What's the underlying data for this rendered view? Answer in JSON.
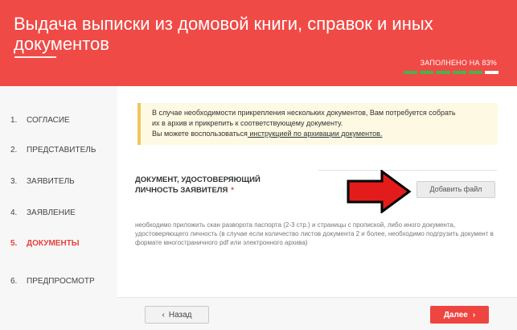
{
  "header": {
    "title": "Выдача выписки из домовой книги, справок и иных документов",
    "progress_label": "ЗАПОЛНЕНО НА 83%",
    "progress_fraction": 0.83,
    "colors": {
      "background": "#f04a46",
      "complete": "#4caf50",
      "incomplete": "#ffffff"
    }
  },
  "sidebar": {
    "steps": [
      {
        "num": "1.",
        "label": "СОГЛАСИЕ"
      },
      {
        "num": "2.",
        "label": "ПРЕДСТАВИТЕЛЬ"
      },
      {
        "num": "3.",
        "label": "ЗАЯВИТЕЛЬ"
      },
      {
        "num": "4.",
        "label": "ЗАЯВЛЕНИЕ"
      },
      {
        "num": "5.",
        "label": "ДОКУМЕНТЫ"
      },
      {
        "num": "6.",
        "label": "ПРЕДПРОСМОТР"
      }
    ]
  },
  "notice": {
    "line1": "В случае необходимости прикрепления нескольких документов, Вам потребуется собрать",
    "line2": "их в архив и прикрепить к соответствующему документу.",
    "line3_prefix": "Вы можете воспользоваться",
    "line3_link": " инструкцией по архивации документов."
  },
  "document": {
    "label": "ДОКУМЕНТ, УДОСТОВЕРЯЮЩИЙ ЛИЧНОСТЬ ЗАЯВИТЕЛЯ",
    "required_mark": "*",
    "add_file_label": "Добавить файл",
    "help": "необходимо приложить скан разворота паспорта (2-3 стр.) и страницы с пропиской, либо иного документа, удостоверяющего личность (в случае если количество листов документа 2 и более, необходимо подгрузить документ в формате многостраничного pdf или электронного архива)"
  },
  "footer": {
    "back_label": "Назад",
    "back_icon": "chevron-left-icon",
    "next_label": "Далее",
    "next_icon": "chevron-right-icon"
  },
  "annotation": {
    "icon": "red-arrow-icon",
    "color": "#e31b1b"
  }
}
